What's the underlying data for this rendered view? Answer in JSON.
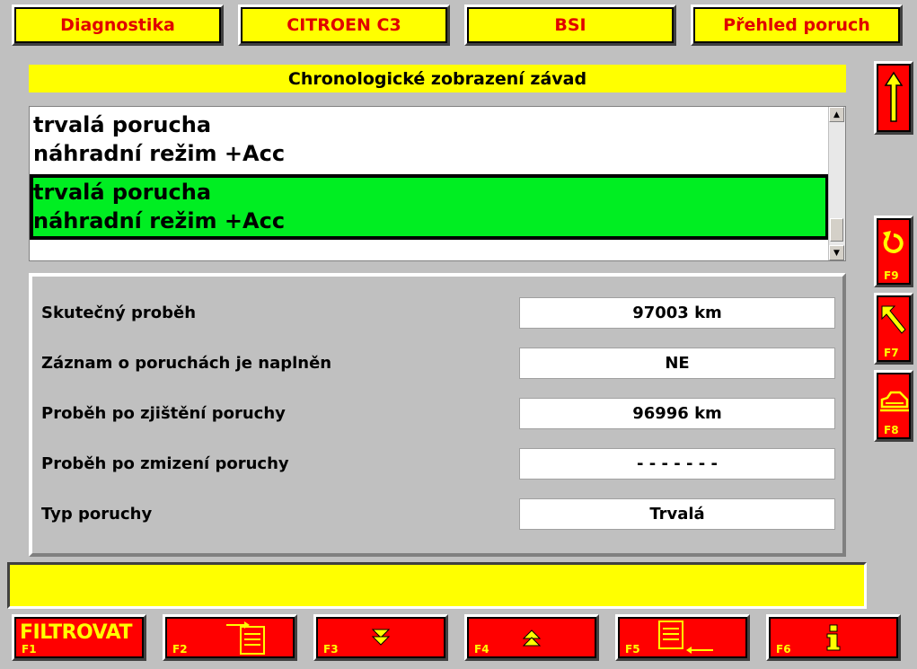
{
  "header": {
    "tabs": [
      {
        "label": "Diagnostika"
      },
      {
        "label": "CITROEN C3"
      },
      {
        "label": "BSI"
      },
      {
        "label": "Přehled poruch"
      }
    ]
  },
  "title": "Chronologické zobrazení závad",
  "faults": [
    {
      "line1": "trvalá porucha",
      "line2": "náhradní režim +Acc"
    },
    {
      "line1": "trvalá porucha",
      "line2": "náhradní režim +Acc"
    }
  ],
  "details": [
    {
      "label": "Skutečný proběh",
      "value": "97003 km"
    },
    {
      "label": "Záznam o poruchách je naplněn",
      "value": "NE"
    },
    {
      "label": "Proběh po zjištění poruchy",
      "value": "96996 km"
    },
    {
      "label": "Proběh po zmizení poruchy",
      "value": "- - - - - - -"
    },
    {
      "label": "Typ poruchy",
      "value": "Trvalá"
    }
  ],
  "status_text": "",
  "side_buttons": [
    {
      "key": ""
    },
    {
      "key": "F9"
    },
    {
      "key": "F7"
    },
    {
      "key": "F8"
    }
  ],
  "function_buttons": [
    {
      "key": "F1",
      "label": "FILTROVAT"
    },
    {
      "key": "F2"
    },
    {
      "key": "F3"
    },
    {
      "key": "F4"
    },
    {
      "key": "F5"
    },
    {
      "key": "F6"
    }
  ],
  "colors": {
    "button_red": "#ff0000",
    "accent_yellow": "#ffff00",
    "selected_green": "#00ee22",
    "header_text": "#e00000"
  }
}
